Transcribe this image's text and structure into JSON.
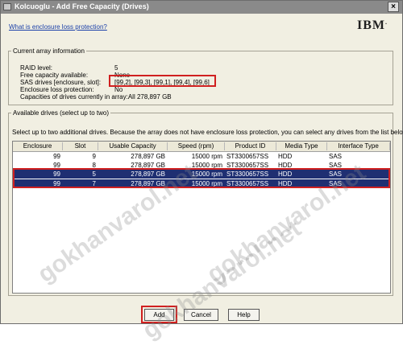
{
  "window": {
    "title": "Kolcuoglu - Add Free Capacity (Drives)"
  },
  "header": {
    "help_link": "What is enclosure loss protection?",
    "logo_text": "IBM"
  },
  "current_array": {
    "legend": "Current array information",
    "fields": [
      {
        "label": "RAID level:",
        "value": "5"
      },
      {
        "label": "Free capacity available:",
        "value": "None"
      },
      {
        "label": "SAS drives [enclosure, slot]:",
        "value": "[99,2], [99,3], [99,1], [99,4], [99,6]"
      },
      {
        "label": "Enclosure loss protection:",
        "value": "No"
      },
      {
        "label": "Capacities of drives currently in array:",
        "value": "All 278,897 GB"
      }
    ]
  },
  "available": {
    "legend": "Available drives (select up to two)",
    "description": "Select up to two additional drives. Because the array does not have enclosure loss protection, you can select any drives from the list below.",
    "columns": [
      "Enclosure",
      "Slot",
      "Usable Capacity",
      "Speed (rpm)",
      "Product ID",
      "Media Type",
      "Interface Type"
    ],
    "rows": [
      {
        "enclosure": "99",
        "slot": "9",
        "capacity": "278,897 GB",
        "speed": "15000 rpm",
        "product": "ST3300657SS",
        "media": "HDD",
        "interface": "SAS",
        "selected": false
      },
      {
        "enclosure": "99",
        "slot": "8",
        "capacity": "278,897 GB",
        "speed": "15000 rpm",
        "product": "ST3300657SS",
        "media": "HDD",
        "interface": "SAS",
        "selected": false
      },
      {
        "enclosure": "99",
        "slot": "5",
        "capacity": "278,897 GB",
        "speed": "15000 rpm",
        "product": "ST3300657SS",
        "media": "HDD",
        "interface": "SAS",
        "selected": true
      },
      {
        "enclosure": "99",
        "slot": "7",
        "capacity": "278,897 GB",
        "speed": "15000 rpm",
        "product": "ST3300657SS",
        "media": "HDD",
        "interface": "SAS",
        "selected": true
      }
    ]
  },
  "buttons": {
    "add": "Add",
    "cancel": "Cancel",
    "help": "Help"
  },
  "watermark": {
    "text": "gokhanvarol.net"
  },
  "colors": {
    "selection": "#1f2f72",
    "highlight": "#d02020",
    "title_bar": "#8a8a8a"
  }
}
